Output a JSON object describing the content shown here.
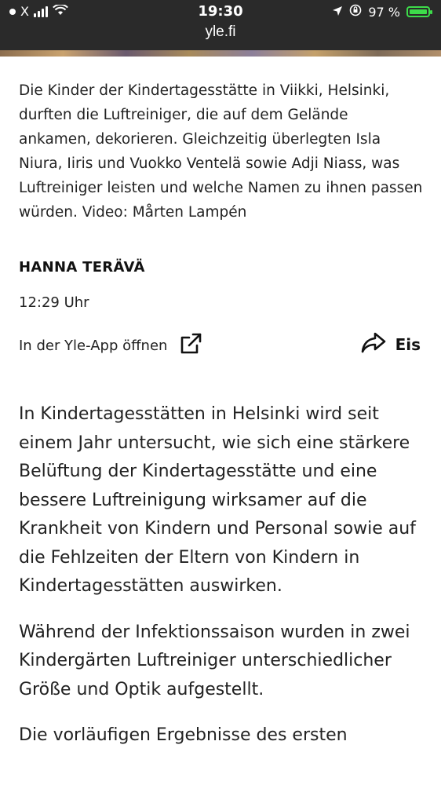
{
  "status_bar": {
    "carrier": "X",
    "time": "19:30",
    "battery_percent": "97 %",
    "battery_color": "#3ddc4a"
  },
  "browser": {
    "url": "yle.fi"
  },
  "article": {
    "caption": "Die Kinder der Kindertagesstätte in Viikki, Helsinki, durften die Luftreiniger, die auf dem Gelände ankamen, dekorieren. Gleichzeitig überlegten Isla Niura, Iiris und Vuokko Ventelä sowie Adji Niass, was Luftreiniger leisten und welche Namen zu ihnen passen würden. Video: Mårten Lampén",
    "author": "HANNA TERÄVÄ",
    "time": "12:29 Uhr",
    "open_in_app": "In der Yle-App öffnen",
    "share_label": "Eis",
    "paragraphs": [
      "In Kindertagesstätten in Helsinki wird seit einem Jahr untersucht, wie sich eine stärkere Belüftung der Kindertagesstätte und eine bessere Luftreinigung wirksamer auf die Krankheit von Kindern und Personal sowie auf die Fehlzeiten der Eltern von Kindern in Kindertagesstätten auswirken.",
      "Während der Infektionssaison wurden in zwei Kindergärten Luftreiniger unterschiedlicher Größe und Optik aufgestellt.",
      "Die vorläufigen Ergebnisse des ersten"
    ]
  }
}
